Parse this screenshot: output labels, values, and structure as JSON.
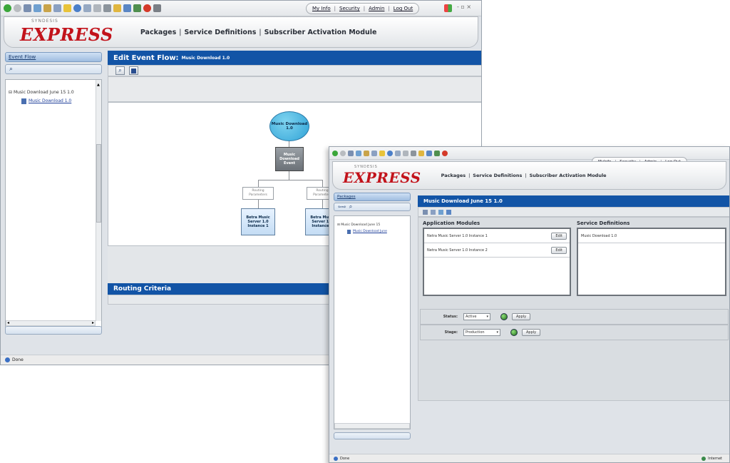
{
  "window1": {
    "user_links": [
      "My Info",
      "Security",
      "Admin",
      "Log Out"
    ],
    "window_controls": "- ▫ ×",
    "logo": {
      "brand": "EXPRESS",
      "sub": "SYNDESIS"
    },
    "nav": {
      "packages": "Packages",
      "service_definitions": "Service Definitions",
      "subscriber_activation": "Subscriber Activation Module"
    },
    "sidebar": {
      "head": "Event Flow",
      "tree_root": "Music Download June 15 1.0",
      "tree_child": "Music Download 1.0"
    },
    "title": {
      "prefix": "Edit Event Flow:",
      "name": "Music Download 1.0"
    },
    "flow": {
      "root": "Music Download 1.0",
      "event": "Music Download Event",
      "routing1": "Routing Parameters",
      "routing2": "Routing Parameters",
      "server1": "Betra Music Server 1.0 Instance 1",
      "server2": "Betra Music Server 1.0 Instance 1"
    },
    "routing_criteria": "Routing Criteria",
    "status": "Done",
    "accent": "#1254a6",
    "brand_color": "#c2131b"
  },
  "window2": {
    "user_links": [
      "MyInfo",
      "Security",
      "Admin",
      "Log Out"
    ],
    "logo": {
      "brand": "EXPRESS",
      "sub": "SYNDESIS"
    },
    "nav": {
      "packages": "Packages",
      "service_definitions": "Service Definitions",
      "subscriber_activation": "Subscriber Activation Module"
    },
    "sidebar": {
      "head": "Packages",
      "tree_root": "Music Download June 15",
      "tree_child": "Music Download June"
    },
    "title": "Music Download June 15 1.0",
    "app_modules": {
      "label": "Application Modules",
      "rows": [
        {
          "name": "Netra Music Server 1.0 Instance 1",
          "button": "Edit"
        },
        {
          "name": "Netra Music Server 1.0 Instance 2",
          "button": "Edit"
        }
      ]
    },
    "service_definitions": {
      "label": "Service Definitions",
      "rows": [
        "Music Download 1.0"
      ]
    },
    "status_field": {
      "label": "Status:",
      "value": "Active",
      "apply": "Apply"
    },
    "stage_field": {
      "label": "Stage:",
      "value": "Production",
      "apply": "Apply"
    },
    "status": "Done",
    "zone": "Internet"
  }
}
